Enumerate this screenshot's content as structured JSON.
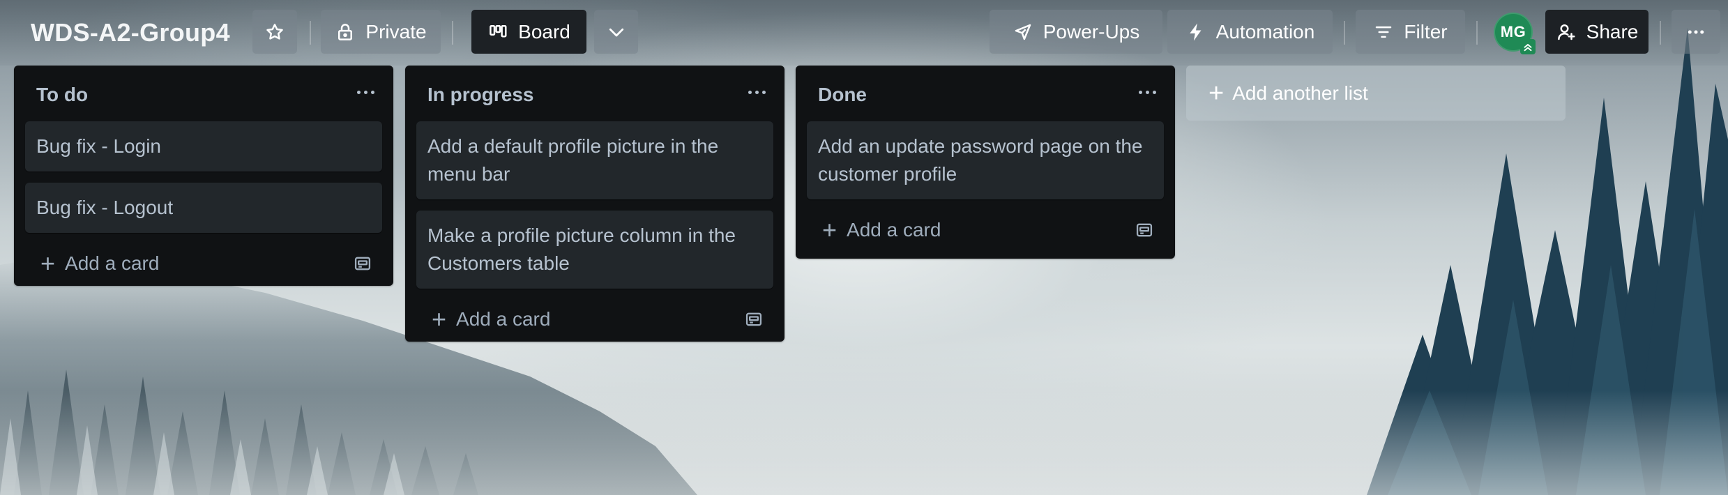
{
  "board": {
    "title": "WDS-A2-Group4",
    "visibility_label": "Private",
    "view_label": "Board"
  },
  "header": {
    "powerups_label": "Power-Ups",
    "automation_label": "Automation",
    "filter_label": "Filter",
    "share_label": "Share",
    "avatar_initials": "MG",
    "avatar_color": "#1f8a55"
  },
  "lists": [
    {
      "title": "To do",
      "cards": [
        "Bug fix - Login",
        "Bug fix - Logout"
      ],
      "add_card_label": "Add a card"
    },
    {
      "title": "In progress",
      "cards": [
        "Add a default profile picture in the menu bar",
        "Make a profile picture column in the Customers table"
      ],
      "add_card_label": "Add a card"
    },
    {
      "title": "Done",
      "cards": [
        "Add an update password page on the customer profile"
      ],
      "add_card_label": "Add a card"
    }
  ],
  "add_list_label": "Add another list",
  "icons": {
    "star": "star-icon",
    "lock": "lock-icon",
    "board": "board-icon",
    "chevron": "chevron-down-icon",
    "rocket": "rocket-icon",
    "bolt": "bolt-icon",
    "filter": "filter-icon",
    "share": "add-person-icon",
    "more": "more-dots-icon",
    "template": "card-template-icon",
    "plus": "plus-icon"
  },
  "colors": {
    "list_bg": "#101214",
    "card_bg": "#22272b",
    "text": "#b6c2cf"
  }
}
